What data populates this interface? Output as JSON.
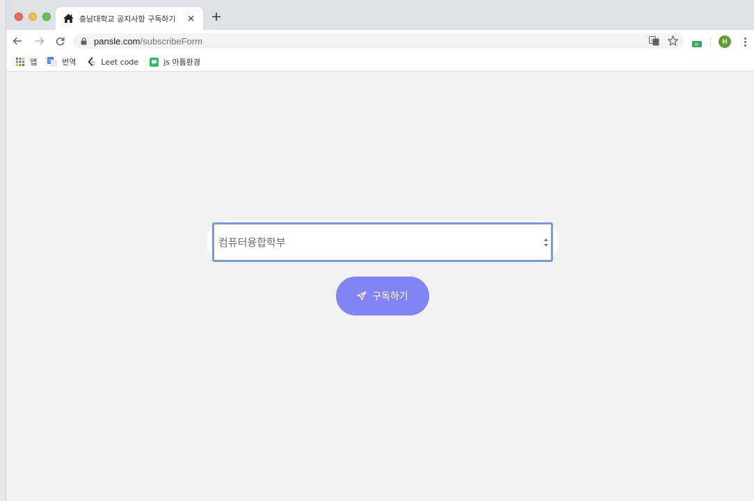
{
  "browser": {
    "tab": {
      "title": "충남대학교 공지사항 구독하기",
      "icon": "home-icon"
    },
    "url": {
      "host": "pansle.com",
      "path": "/subscribeForm"
    },
    "profile_initial": "H",
    "extension_badge": "AC"
  },
  "bookmarks": [
    {
      "label": "앱",
      "icon": "apps-grid-icon"
    },
    {
      "label": "번역",
      "icon": "translate-icon"
    },
    {
      "label": "Leet code",
      "icon": "leetcode-icon"
    },
    {
      "label": "js 아톰환경",
      "icon": "chat-bubble-icon"
    }
  ],
  "form": {
    "select_value": "컴퓨터융합학부",
    "submit_label": "구독하기",
    "submit_icon": "paper-plane-icon"
  },
  "colors": {
    "accent_button": "#8283f5",
    "select_border": "#7598e6",
    "page_background": "#f2f2f2"
  }
}
